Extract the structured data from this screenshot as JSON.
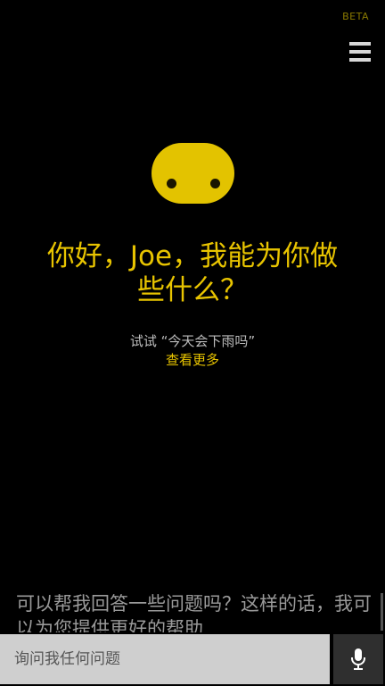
{
  "header": {
    "badge": "BETA",
    "menu_icon": "hamburger-menu-icon"
  },
  "assistant": {
    "avatar_icon": "cortana-face-icon",
    "greeting": "你好，Joe，我能为你做些什么？",
    "suggestion": "试试 “今天会下雨吗”",
    "see_more": "查看更多"
  },
  "prompt": {
    "text": "可以帮我回答一些问题吗？这样的话，我可以为您提供更好的帮助"
  },
  "input": {
    "placeholder": "询问我任何问题",
    "value": "",
    "mic_icon": "microphone-icon"
  },
  "colors": {
    "accent": "#e8c400",
    "background": "#000000",
    "input_bg": "#cfcfcf",
    "mic_bg": "#2f2f2f"
  }
}
